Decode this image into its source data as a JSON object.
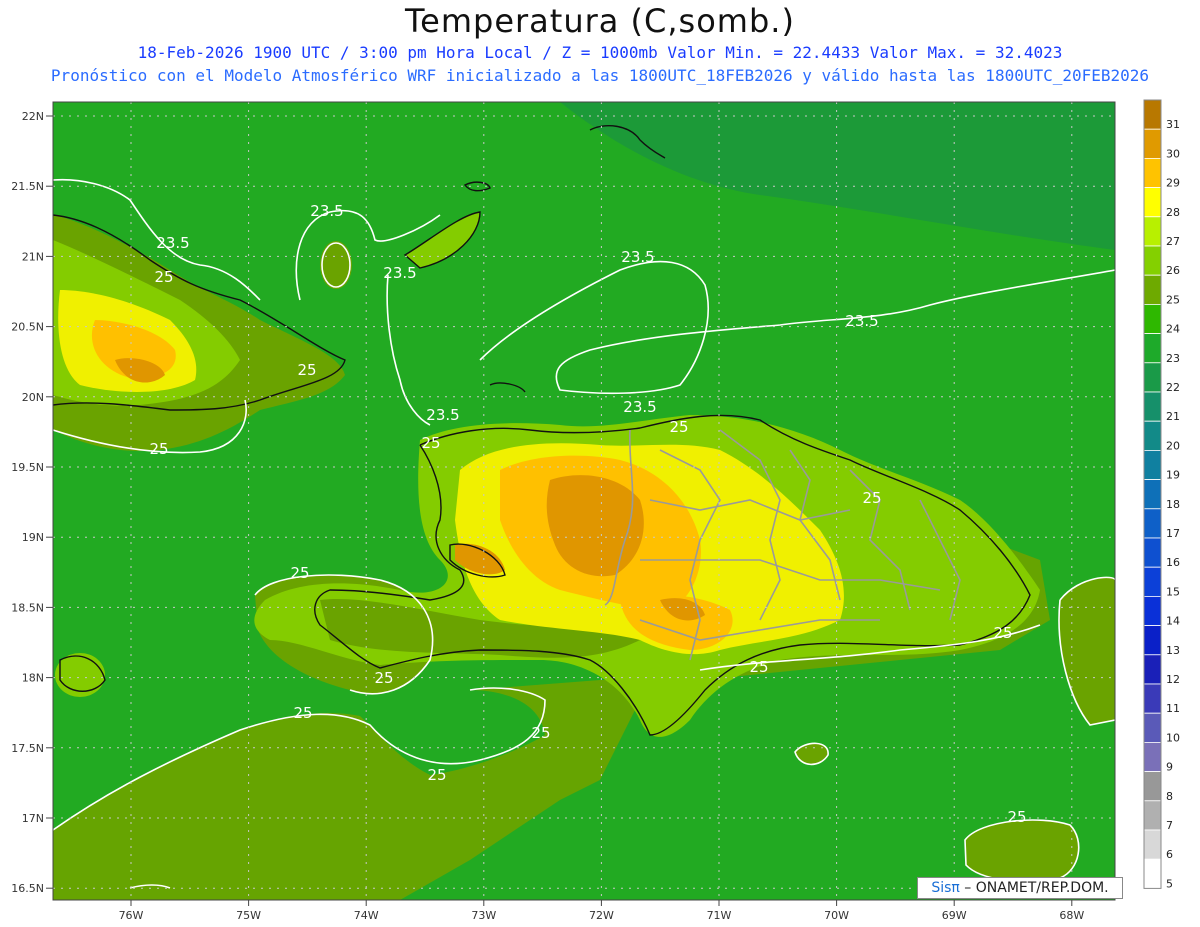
{
  "title": "Temperatura (C,somb.)",
  "subtitle_line1": "18-Feb-2026  1900 UTC / 3:00 pm Hora Local / Z = 1000mb   Valor Min. = 22.4433  Valor Max. = 32.4023",
  "subtitle_line2": "Pronóstico con el Modelo Atmosférico WRF inicializado a las 1800UTC_18FEB2026 y válido hasta las  1800UTC_20FEB2026",
  "credit": {
    "sis": "Sisπ",
    "rest": " – ONAMET/REP.DOM."
  },
  "lat_labels": [
    "22N",
    "21.5N",
    "21N",
    "20.5N",
    "20N",
    "19.5N",
    "19N",
    "18.5N",
    "18N",
    "17.5N",
    "17N",
    "16.5N"
  ],
  "lon_labels": [
    "76W",
    "75W",
    "74W",
    "73W",
    "72W",
    "71W",
    "70W",
    "69W",
    "68W"
  ],
  "contour_labels": [
    "23.5",
    "23.5",
    "25",
    "23.5",
    "23.5",
    "23.5",
    "25",
    "25",
    "23.5",
    "23.5",
    "25",
    "25",
    "25",
    "25",
    "25",
    "25",
    "25",
    "25",
    "25",
    "25"
  ],
  "colorbar": {
    "ticks": [
      "31",
      "30",
      "29",
      "28",
      "27",
      "26",
      "25",
      "24",
      "23",
      "22",
      "21",
      "20",
      "19",
      "18",
      "17",
      "16",
      "15",
      "14",
      "13",
      "12",
      "11",
      "10",
      "9",
      "8",
      "7",
      "6",
      "5"
    ],
    "colors": [
      "#b87800",
      "#e09a00",
      "#ffc300",
      "#ffff00",
      "#b8f000",
      "#84d000",
      "#6eaa00",
      "#2eb800",
      "#1eaa2a",
      "#1a9a48",
      "#16906a",
      "#128a88",
      "#1080a0",
      "#0e70b8",
      "#0e60c8",
      "#0e50d0",
      "#0c40d8",
      "#0a30d8",
      "#0a20c8",
      "#1a20b8",
      "#3a3ab8",
      "#5a5ab8",
      "#7a70b8",
      "#989898",
      "#b0b0b0",
      "#d8d8d8",
      "#ffffff"
    ]
  },
  "colors": {
    "sea": "#20a820",
    "sea_dark": "#1e9a3c",
    "land_25": "#6aa300",
    "land_26": "#82c800",
    "land_27": "#b0e600",
    "land_28": "#f0f000",
    "land_29": "#ffc000",
    "land_30": "#e09600",
    "land_31": "#c07800"
  }
}
